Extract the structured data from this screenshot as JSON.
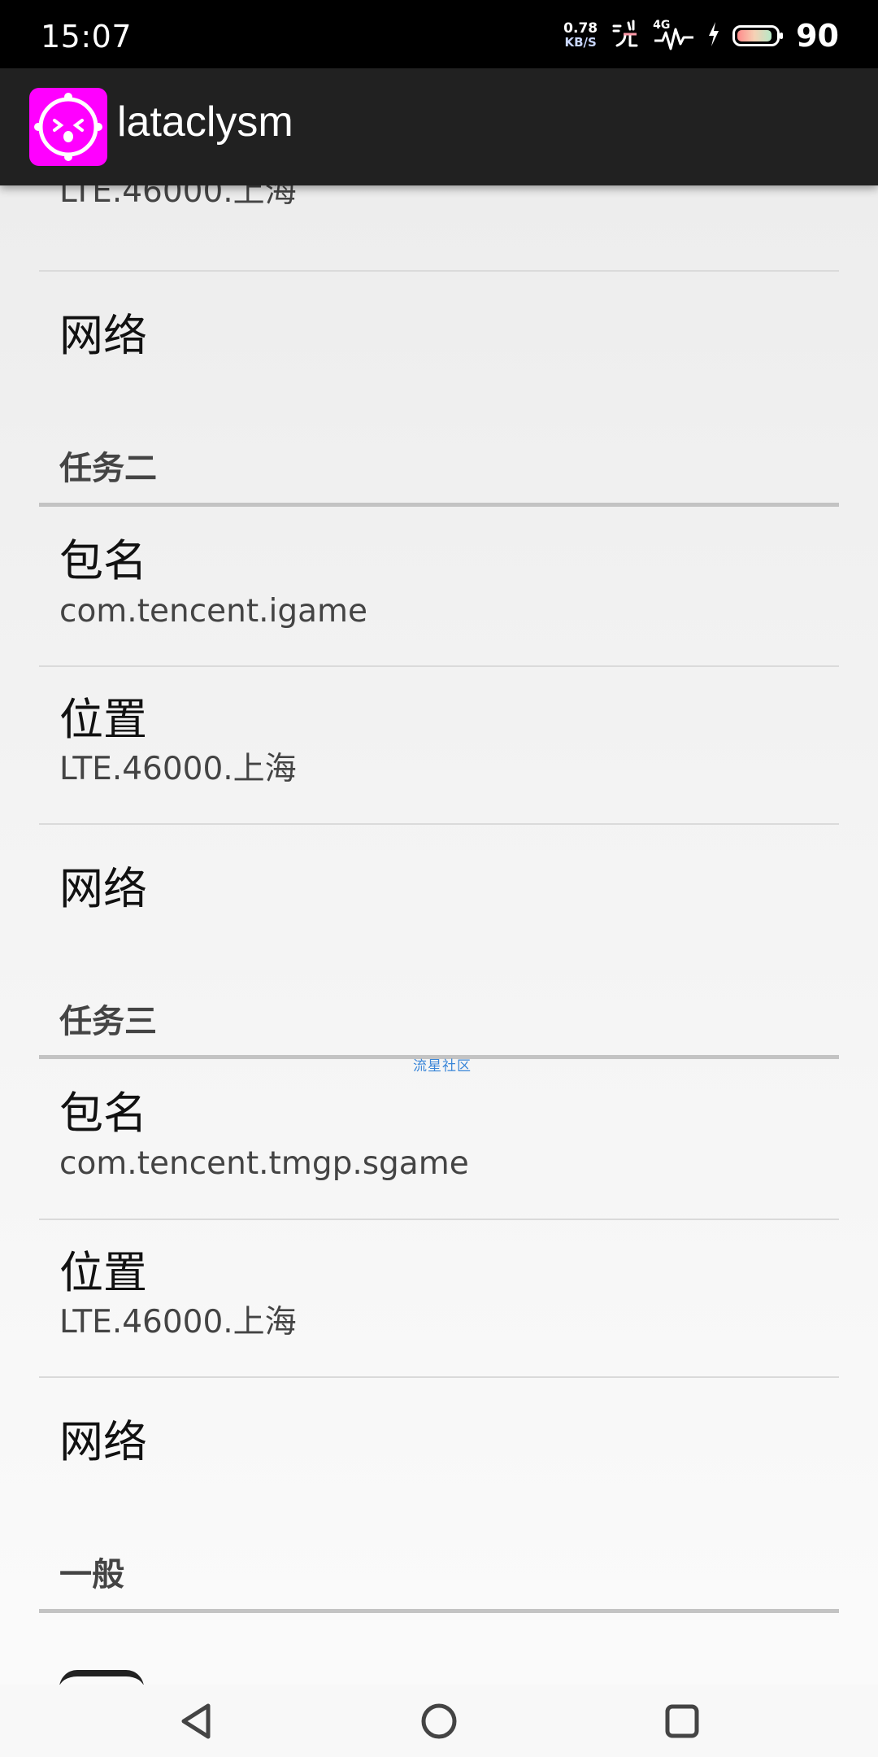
{
  "status_bar": {
    "time": "15:07",
    "net_speed_value": "0.78",
    "net_speed_unit": "KB/S",
    "network_type": "4G",
    "battery_level": "90",
    "battery_fraction": 0.9,
    "icons": [
      "hotspot-icon",
      "signal-icon",
      "charging-icon",
      "battery-icon"
    ]
  },
  "app_bar": {
    "title": "lataclysm",
    "icon": "app-logo-icon",
    "icon_color": "#ff00ff"
  },
  "list": {
    "top_partial": {
      "summary": "LTE.46000.上海"
    },
    "network_label_1": "网络",
    "task2": {
      "header": "任务二",
      "package_title": "包名",
      "package_value": "com.tencent.igame",
      "location_title": "位置",
      "location_value": "LTE.46000.上海",
      "network_title": "网络"
    },
    "task3": {
      "header": "任务三",
      "package_title": "包名",
      "package_value": "com.tencent.tmgp.sgame",
      "location_title": "位置",
      "location_value": "LTE.46000.上海",
      "network_title": "网络"
    },
    "general": {
      "header": "一般"
    }
  },
  "watermark": "流星社区",
  "nav_bar": {
    "icons": [
      "back-icon",
      "home-icon",
      "recents-icon"
    ]
  }
}
